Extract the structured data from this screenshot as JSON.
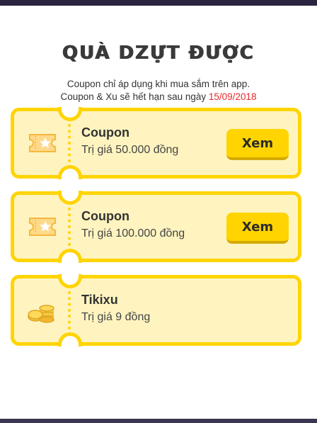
{
  "modal": {
    "title": "QUÀ DZỰT ĐƯỢC",
    "subtitle_line1": "Coupon chỉ áp dụng khi mua sắm trên app.",
    "subtitle_line2_prefix": "Coupon & Xu sẽ hết hạn sau ngày ",
    "expiry_date": "15/09/2018"
  },
  "rewards": [
    {
      "icon": "ticket-icon",
      "title": "Coupon",
      "value": "Trị giá 50.000 đồng",
      "button_label": "Xem"
    },
    {
      "icon": "ticket-icon",
      "title": "Coupon",
      "value": "Trị giá 100.000 đồng",
      "button_label": "Xem"
    },
    {
      "icon": "coins-icon",
      "title": "Tikixu",
      "value": "Trị giá 9 đồng"
    }
  ],
  "colors": {
    "accent": "#ffd400",
    "card_background": "#fff4c0",
    "date_red": "#e8262a"
  }
}
